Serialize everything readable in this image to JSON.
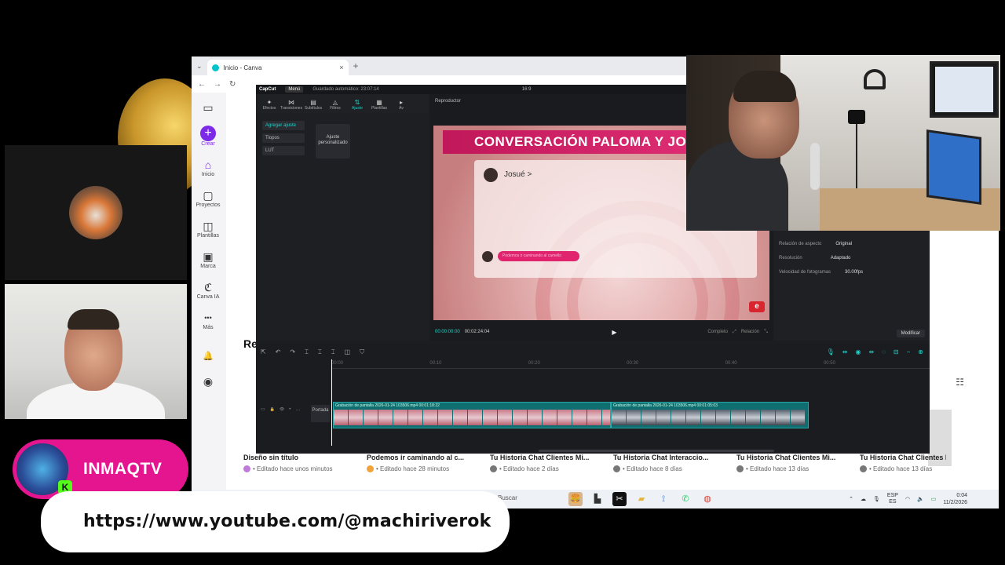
{
  "browser": {
    "tab_title": "Inicio - Canva",
    "tab_close": "×",
    "new_tab": "+",
    "tab_menu": "⌄",
    "nav_back": "←",
    "nav_forward": "→",
    "nav_reload": "↻"
  },
  "canva": {
    "rail": [
      {
        "label": "",
        "icon": "sidebar-toggle-icon",
        "glyph": "▭"
      },
      {
        "label": "Crear",
        "icon": "plus-icon",
        "glyph": "+"
      },
      {
        "label": "Inicio",
        "icon": "home-icon",
        "glyph": "⌂"
      },
      {
        "label": "Proyectos",
        "icon": "folder-icon",
        "glyph": "▢"
      },
      {
        "label": "Plantillas",
        "icon": "templates-icon",
        "glyph": "◫"
      },
      {
        "label": "Marca",
        "icon": "brand-icon",
        "glyph": "▣"
      },
      {
        "label": "Canva IA",
        "icon": "canva-ai-icon",
        "glyph": "ℭ"
      },
      {
        "label": "Más",
        "icon": "more-icon",
        "glyph": "•••"
      }
    ],
    "bell": "🔔",
    "profile": "◉",
    "recent_heading": "Re",
    "list_icon": "☷",
    "help": "?",
    "cards": [
      {
        "title": "Diseño sin título",
        "sub": "• Editado hace unos minutos",
        "color": "#c07ad8"
      },
      {
        "title": "Podemos ir caminando al c...",
        "sub": "• Editado hace 28 minutos",
        "color": "#f2a23a"
      },
      {
        "title": "Tu Historia Chat Clientes Mi...",
        "sub": "• Editado hace 2 días",
        "color": "#777777"
      },
      {
        "title": "Tu Historia Chat Interaccio...",
        "sub": "• Editado hace 8 días",
        "color": "#777777"
      },
      {
        "title": "Tu Historia Chat Clientes Mi...",
        "sub": "• Editado hace 13 días",
        "color": "#777777"
      },
      {
        "title": "Tu Historia Chat Clientes M...",
        "sub": "• Editado hace 13 días",
        "color": "#777777"
      }
    ]
  },
  "taskbar": {
    "search": "Buscar",
    "lang_top": "ESP",
    "lang_bottom": "ES",
    "time": "0:04",
    "date": "11/2/2026"
  },
  "capcut": {
    "app_name": "CapCut",
    "menu": "Menú",
    "autosave": "Guardado automático: 23:07:14",
    "ratio": "16:9",
    "tools": [
      {
        "label": "Efectos",
        "glyph": "✦"
      },
      {
        "label": "Transiciones",
        "glyph": "⋈"
      },
      {
        "label": "Subtítulos",
        "glyph": "▤"
      },
      {
        "label": "Filtros",
        "glyph": "◬"
      },
      {
        "label": "Ajuste",
        "glyph": "⇅"
      },
      {
        "label": "Plantillas",
        "glyph": "▦"
      },
      {
        "label": "Av",
        "glyph": "▸"
      }
    ],
    "side_items": [
      "Agregar ajuste",
      "Tiopos",
      "LUT"
    ],
    "adjust_card": "Ajuste personalizado",
    "player_label": "Reproductor",
    "video_title": "CONVERSACIÓN PALOMA Y JOSUÉ",
    "chat_name": "Josué >",
    "chat_icons": "✆ ▭",
    "chat_bubble": "Podemos ir caminando al camello",
    "logo": "e",
    "time_current": "00:00:00:00",
    "time_total": "00:02:24:04",
    "play": "▶",
    "player_btns": [
      "Completo",
      "⤢",
      "Relación",
      "⤡"
    ],
    "props": [
      {
        "label": "Relación de aspecto",
        "value": "Original"
      },
      {
        "label": "Resolución",
        "value": "Adaptado"
      },
      {
        "label": "Velocidad de fotogramas",
        "value": "30.00fps"
      }
    ],
    "modify": "Modificar",
    "timeline_tools": [
      "⇱",
      "↶",
      "↷",
      "⌶",
      "⌶",
      "⌶",
      "◫",
      "⛉"
    ],
    "timeline_right": [
      "🎙",
      "⇹",
      "◉",
      "⇹",
      "◌",
      "⊟",
      "−",
      "⊕"
    ],
    "ruler": [
      "00:00",
      "00:10",
      "00:20",
      "00:30",
      "00:40",
      "00:50"
    ],
    "track_icons": [
      "▭",
      "🔒",
      "👁",
      "•",
      "…"
    ],
    "cover": "Portada",
    "clip1": "Grabación de pantalla 2026-01-24 103506.mp4  00:01:18:22",
    "clip2": "Grabación de pantalla 2026-01-24 103506.mp4  00:01:05:03"
  },
  "overlay": {
    "streamer": "INMAQTV",
    "kick_badge": "K",
    "youtube_url": "https://www.youtube.com/@machiriverok"
  }
}
